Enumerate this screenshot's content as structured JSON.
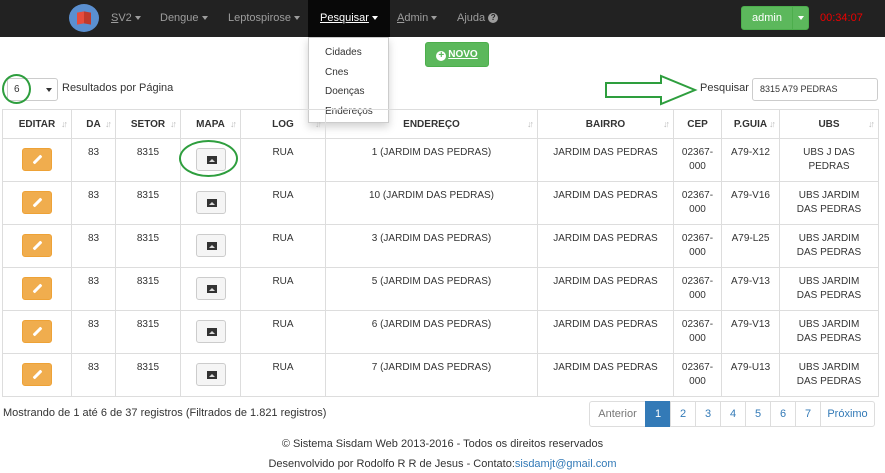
{
  "nav": {
    "items": [
      {
        "label": "SV2",
        "underline": "S"
      },
      {
        "label": "Dengue"
      },
      {
        "label": "Leptospirose"
      },
      {
        "label": "Pesquisar",
        "underline": "P"
      },
      {
        "label": "Admin",
        "underline": "A"
      },
      {
        "label": "Ajuda"
      }
    ],
    "user_label": "admin",
    "timer": "00:34:07"
  },
  "dropdown": {
    "items": [
      "Cidades",
      "Cnes",
      "Doenças",
      "Endereços"
    ]
  },
  "toolbar": {
    "new_label": "NOVO",
    "page_size": "6",
    "page_size_label": "Resultados por Página",
    "search_label": "Pesquisar",
    "search_value": "8315 A79 PEDRAS"
  },
  "table": {
    "headers": [
      "EDITAR",
      "DA",
      "SETOR",
      "MAPA",
      "LOG",
      "ENDEREÇO",
      "BAIRRO",
      "CEP",
      "P.GUIA",
      "UBS"
    ],
    "rows": [
      {
        "da": "83",
        "setor": "8315",
        "log": "RUA",
        "endereco": "1 (JARDIM DAS PEDRAS)",
        "bairro": "JARDIM DAS PEDRAS",
        "cep1": "02367-",
        "cep2": "000",
        "pguia": "A79-X12",
        "ubs1": "UBS J DAS",
        "ubs2": "PEDRAS"
      },
      {
        "da": "83",
        "setor": "8315",
        "log": "RUA",
        "endereco": "10 (JARDIM DAS PEDRAS)",
        "bairro": "JARDIM DAS PEDRAS",
        "cep1": "02367-",
        "cep2": "000",
        "pguia": "A79-V16",
        "ubs1": "UBS JARDIM",
        "ubs2": "DAS PEDRAS"
      },
      {
        "da": "83",
        "setor": "8315",
        "log": "RUA",
        "endereco": "3 (JARDIM DAS PEDRAS)",
        "bairro": "JARDIM DAS PEDRAS",
        "cep1": "02367-",
        "cep2": "000",
        "pguia": "A79-L25",
        "ubs1": "UBS JARDIM",
        "ubs2": "DAS PEDRAS"
      },
      {
        "da": "83",
        "setor": "8315",
        "log": "RUA",
        "endereco": "5 (JARDIM DAS PEDRAS)",
        "bairro": "JARDIM DAS PEDRAS",
        "cep1": "02367-",
        "cep2": "000",
        "pguia": "A79-V13",
        "ubs1": "UBS JARDIM",
        "ubs2": "DAS PEDRAS"
      },
      {
        "da": "83",
        "setor": "8315",
        "log": "RUA",
        "endereco": "6 (JARDIM DAS PEDRAS)",
        "bairro": "JARDIM DAS PEDRAS",
        "cep1": "02367-",
        "cep2": "000",
        "pguia": "A79-V13",
        "ubs1": "UBS JARDIM",
        "ubs2": "DAS PEDRAS"
      },
      {
        "da": "83",
        "setor": "8315",
        "log": "RUA",
        "endereco": "7 (JARDIM DAS PEDRAS)",
        "bairro": "JARDIM DAS PEDRAS",
        "cep1": "02367-",
        "cep2": "000",
        "pguia": "A79-U13",
        "ubs1": "UBS JARDIM",
        "ubs2": "DAS PEDRAS"
      }
    ]
  },
  "footer": {
    "info": "Mostrando de 1 até 6 de 37 registros (Filtrados de 1.821 registros)",
    "prev": "Anterior",
    "pages": [
      "1",
      "2",
      "3",
      "4",
      "5",
      "6",
      "7"
    ],
    "active_page": "1",
    "next": "Próximo",
    "copyright": "© Sistema Sisdam Web 2013-2016 - Todos os direitos reservados",
    "dev_prefix": "Desenvolvido por Rodolfo R R de Jesus - Contato:",
    "dev_email": "sisdamjt@gmail.com"
  },
  "colors": {
    "navbar": "#222222",
    "success": "#5cb85c",
    "warning": "#f0ad4e",
    "primary": "#337ab7",
    "annotation": "#2e9e3e",
    "timer": "#ee0000"
  }
}
